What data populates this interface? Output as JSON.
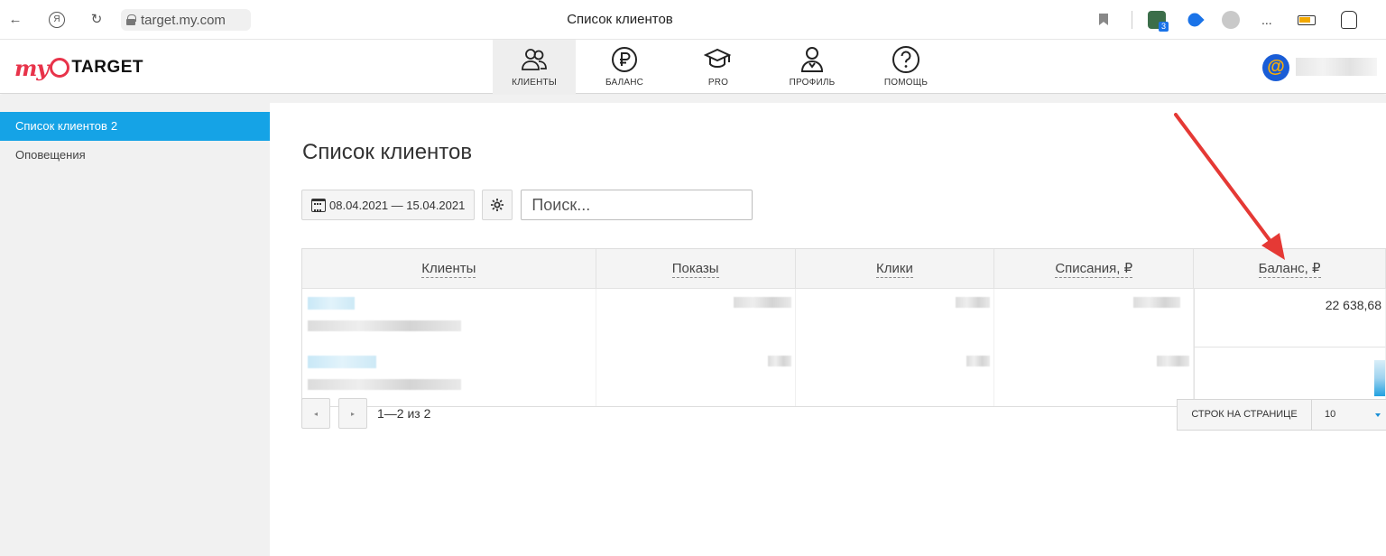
{
  "browser": {
    "url": "target.my.com",
    "tab_title": "Список клиентов",
    "yandex_label": "Я",
    "ext_badge": "3",
    "ext_more": "...",
    "icons": [
      "back-arrow-icon",
      "yandex-icon",
      "reload-icon",
      "lock-icon",
      "bookmark-icon",
      "extension-icon",
      "battery-icon",
      "profile-icon"
    ]
  },
  "header": {
    "logo_my": "my",
    "logo_target": "TARGET",
    "nav": [
      {
        "label": "КЛИЕНТЫ",
        "icon": "clients-icon",
        "active": true
      },
      {
        "label": "БАЛАНС",
        "icon": "ruble-icon",
        "active": false
      },
      {
        "label": "PRO",
        "icon": "graduation-cap-icon",
        "active": false
      },
      {
        "label": "ПРОФИЛЬ",
        "icon": "profile-icon",
        "active": false
      },
      {
        "label": "ПОМОЩЬ",
        "icon": "help-icon",
        "active": false
      }
    ],
    "avatar_symbol": "@"
  },
  "sidebar": {
    "items": [
      {
        "label": "Список клиентов",
        "count": "2",
        "active": true
      },
      {
        "label": "Оповещения",
        "count": "",
        "active": false
      }
    ]
  },
  "main": {
    "title": "Список клиентов",
    "date_range": "08.04.2021 — 15.04.2021",
    "search_placeholder": "Поиск...",
    "table": {
      "columns": [
        "Клиенты",
        "Показы",
        "Клики",
        "Списания, ₽",
        "Баланс, ₽"
      ],
      "rows": [
        {
          "balance": "22 638,68"
        },
        {
          "balance": ""
        }
      ]
    },
    "pagination": {
      "prev": "◂",
      "next": "▸",
      "info": "1—2 из 2",
      "rows_label": "СТРОК НА СТРАНИЦЕ",
      "rows_value": "10"
    }
  },
  "colors": {
    "accent": "#15a3e6",
    "brand": "#e8334a",
    "annotation_arrow": "#e53935"
  }
}
